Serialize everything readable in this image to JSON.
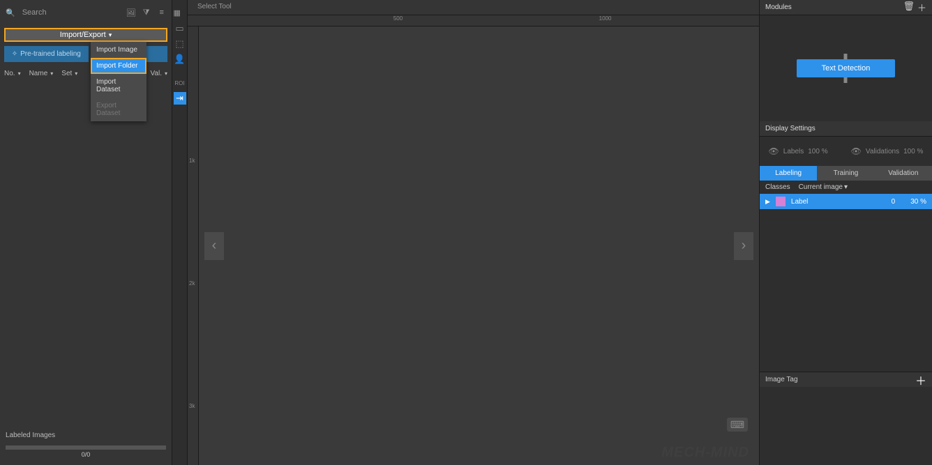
{
  "search": {
    "placeholder": "Search"
  },
  "import_export_label": "Import/Export",
  "dropdown": {
    "import_image": "Import Image",
    "import_folder": "Import Folder",
    "import_dataset": "Import Dataset",
    "export_dataset": "Export Dataset"
  },
  "pretrained_label": "Pre-trained labeling",
  "labeling_label_suffix": "ng",
  "columns": {
    "no": "No.",
    "name": "Name",
    "set": "Set",
    "val": "Val."
  },
  "labeled_images": "Labeled Images",
  "progress_text": "0/0",
  "select_tool": "Select Tool",
  "ruler_ticks": {
    "t500": "500",
    "t1000": "1000",
    "t1k": "1k",
    "t2k": "2k",
    "t3k": "3k"
  },
  "modules": {
    "title": "Modules"
  },
  "text_detection": "Text Detection",
  "display_settings": {
    "title": "Display Settings",
    "labels": "Labels",
    "labels_pct": "100 %",
    "validations": "Validations",
    "validations_pct": "100 %"
  },
  "tabs": {
    "labeling": "Labeling",
    "training": "Training",
    "validation": "Validation"
  },
  "classes_header": "Classes",
  "current_image": "Current image",
  "class_row": {
    "name": "Label",
    "count": "0",
    "pct": "30 %"
  },
  "image_tag": "Image Tag",
  "watermark": "MECH‑MIND"
}
